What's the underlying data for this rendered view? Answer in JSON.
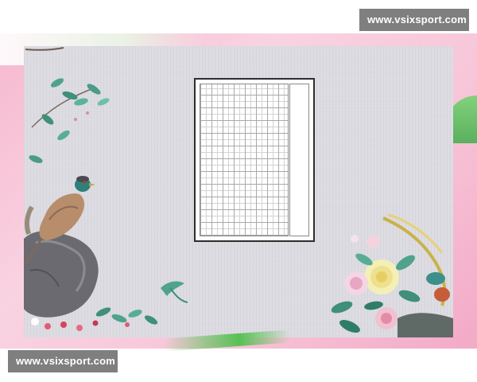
{
  "watermarks": {
    "top": "www.vsixsport.com",
    "bottom": "www.vsixsport.com"
  },
  "colors": {
    "frame_pink": "#f6b8cf",
    "canvas_gray": "#dcdbe1",
    "accent_green": "#57c154",
    "grid_line": "#a9a9a9",
    "watermark_bg": "#7f7f7f"
  },
  "decor": {
    "left_illustration": "pheasant-on-rock-icon",
    "right_illustration": "peony-flowers-icon",
    "branch": "leafy-branch-icon"
  }
}
